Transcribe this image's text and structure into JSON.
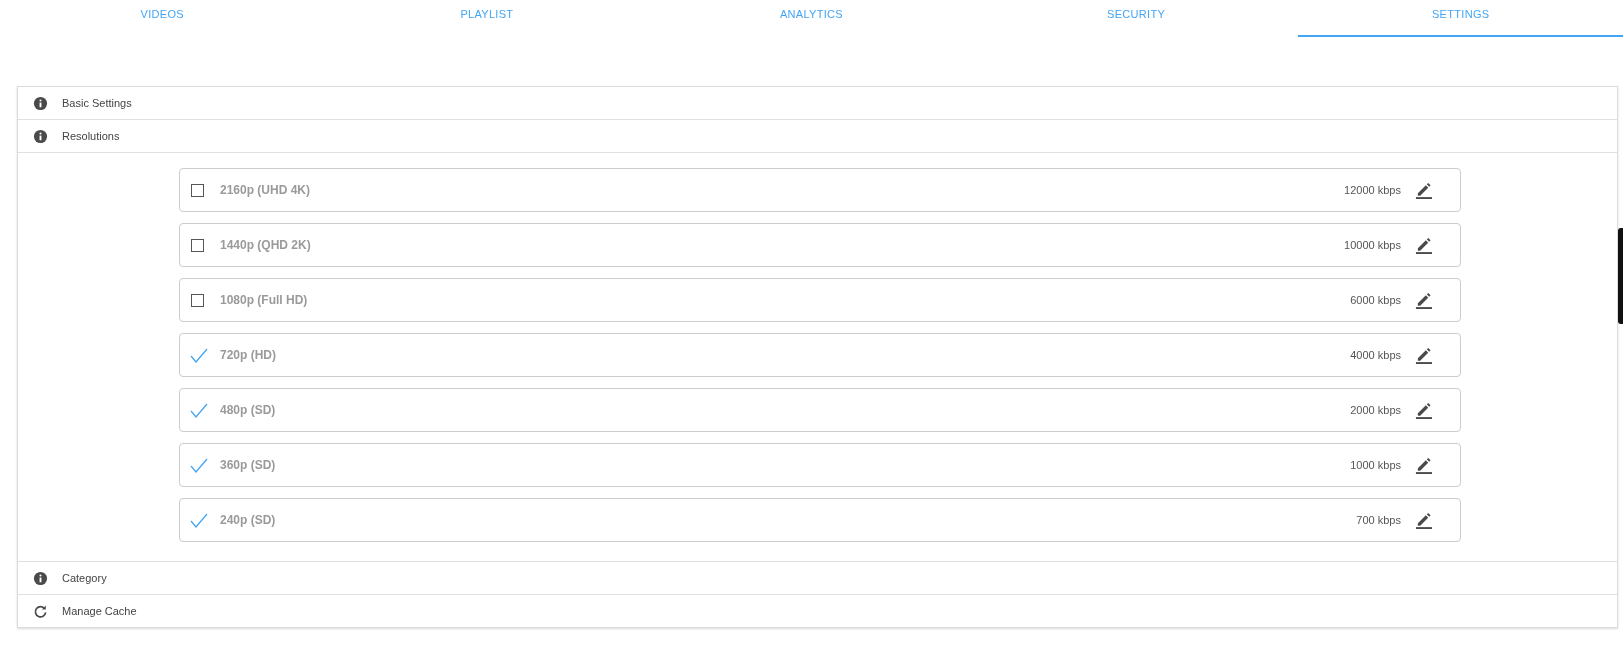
{
  "tabs": [
    {
      "label": "VIDEOS",
      "selected": false
    },
    {
      "label": "PLAYLIST",
      "selected": false
    },
    {
      "label": "ANALYTICS",
      "selected": false
    },
    {
      "label": "SECURITY",
      "selected": false
    },
    {
      "label": "SETTINGS",
      "selected": true
    }
  ],
  "sections": [
    {
      "kind": "info",
      "label": "Basic Settings"
    },
    {
      "kind": "info",
      "label": "Resolutions",
      "resolutions": [
        {
          "name": "2160p (UHD 4K)",
          "checked": false,
          "bitrate": "12000 kbps"
        },
        {
          "name": "1440p (QHD 2K)",
          "checked": false,
          "bitrate": "10000 kbps"
        },
        {
          "name": "1080p (Full HD)",
          "checked": false,
          "bitrate": "6000 kbps"
        },
        {
          "name": "720p (HD)",
          "checked": true,
          "bitrate": "4000 kbps"
        },
        {
          "name": "480p (SD)",
          "checked": true,
          "bitrate": "2000 kbps"
        },
        {
          "name": "360p (SD)",
          "checked": true,
          "bitrate": "1000 kbps"
        },
        {
          "name": "240p (SD)",
          "checked": true,
          "bitrate": "700 kbps"
        }
      ]
    },
    {
      "kind": "info",
      "label": "Category"
    },
    {
      "kind": "refresh",
      "label": "Manage Cache"
    }
  ]
}
